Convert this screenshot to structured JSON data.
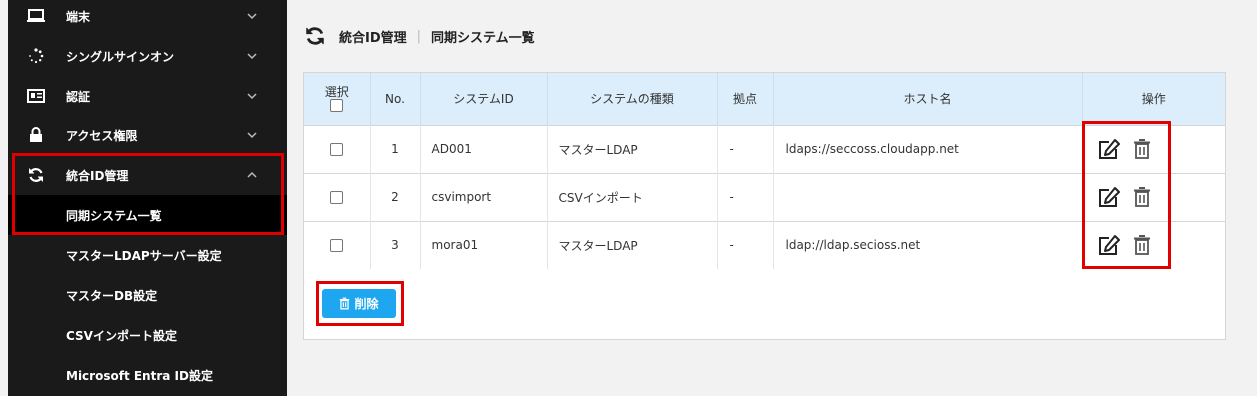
{
  "sidebar": {
    "items": [
      {
        "label": "端末",
        "icon": "laptop-icon",
        "chevron": "down"
      },
      {
        "label": "シングルサインオン",
        "icon": "spinner-icon",
        "chevron": "down"
      },
      {
        "label": "認証",
        "icon": "id-card-icon",
        "chevron": "down"
      },
      {
        "label": "アクセス権限",
        "icon": "lock-icon",
        "chevron": "down"
      },
      {
        "label": "統合ID管理",
        "icon": "sync-icon",
        "chevron": "up"
      }
    ],
    "subitems": [
      {
        "label": "同期システム一覧",
        "active": true
      },
      {
        "label": "マスターLDAPサーバー設定"
      },
      {
        "label": "マスターDB設定"
      },
      {
        "label": "CSVインポート設定"
      },
      {
        "label": "Microsoft Entra ID設定"
      }
    ]
  },
  "header": {
    "title": "統合ID管理",
    "subtitle": "同期システム一覧",
    "icon": "sync-icon"
  },
  "table": {
    "columns": [
      "選択",
      "No.",
      "システムID",
      "システムの種類",
      "拠点",
      "ホスト名",
      "操作"
    ],
    "rows": [
      {
        "no": "1",
        "system_id": "AD001",
        "type": "マスターLDAP",
        "site": "-",
        "host": "ldaps://seccoss.cloudapp.net"
      },
      {
        "no": "2",
        "system_id": "csvimport",
        "type": "CSVインポート",
        "site": "-",
        "host": ""
      },
      {
        "no": "3",
        "system_id": "mora01",
        "type": "マスターLDAP",
        "site": "-",
        "host": "ldap://ldap.secioss.net"
      }
    ]
  },
  "actions": {
    "delete_label": "削除"
  },
  "colors": {
    "sidebar_bg": "#1a1a1a",
    "highlight": "#e00000",
    "table_header_bg": "#dceefb",
    "button_bg": "#1ea7f0"
  }
}
